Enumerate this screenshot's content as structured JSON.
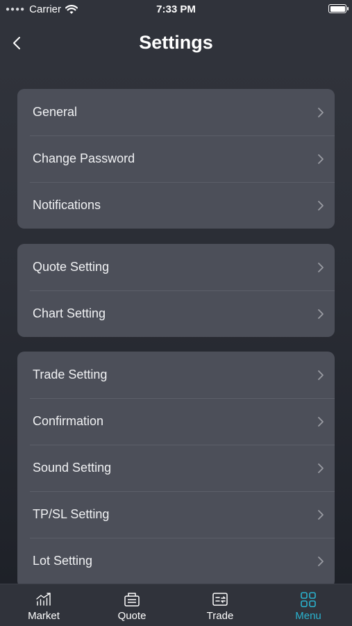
{
  "status_bar": {
    "carrier": "Carrier",
    "time": "7:33 PM"
  },
  "header": {
    "title": "Settings",
    "back_icon": "chevron-left-icon"
  },
  "groups": [
    {
      "items": [
        {
          "label": "General"
        },
        {
          "label": "Change Password"
        },
        {
          "label": "Notifications"
        }
      ]
    },
    {
      "items": [
        {
          "label": "Quote Setting"
        },
        {
          "label": "Chart Setting"
        }
      ]
    },
    {
      "items": [
        {
          "label": "Trade Setting"
        },
        {
          "label": "Confirmation"
        },
        {
          "label": "Sound Setting"
        },
        {
          "label": "TP/SL Setting"
        },
        {
          "label": "Lot Setting"
        }
      ]
    }
  ],
  "tabbar": {
    "tabs": [
      {
        "label": "Market",
        "icon": "chart-icon"
      },
      {
        "label": "Quote",
        "icon": "quote-icon"
      },
      {
        "label": "Trade",
        "icon": "trade-icon"
      },
      {
        "label": "Menu",
        "icon": "grid-icon",
        "active": true
      }
    ],
    "active_color": "#2ab3cf"
  },
  "colors": {
    "background": "#2a2d35",
    "card": "#4c4f59",
    "accent": "#2ab3cf"
  }
}
